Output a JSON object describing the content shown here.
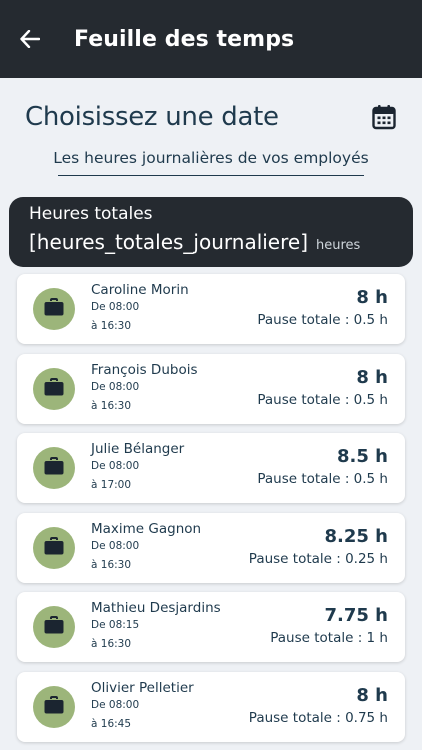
{
  "appbar": {
    "title": "Feuille des temps"
  },
  "header": {
    "title": "Choisissez une date",
    "subtitle": "Les heures journalières de vos employés"
  },
  "total": {
    "label": "Heures totales",
    "value": "[heures_totales_journaliere]",
    "unit": "heures"
  },
  "employees": [
    {
      "name": "Caroline Morin",
      "start": "De 08:00",
      "end": "à 16:30",
      "hours": "8 h",
      "pause": "Pause totale : 0.5 h"
    },
    {
      "name": "François Dubois",
      "start": "De 08:00",
      "end": "à 16:30",
      "hours": "8 h",
      "pause": "Pause totale : 0.5 h"
    },
    {
      "name": "Julie Bélanger",
      "start": "De 08:00",
      "end": "à 17:00",
      "hours": "8.5 h",
      "pause": "Pause totale : 0.5 h"
    },
    {
      "name": "Maxime Gagnon",
      "start": "De 08:00",
      "end": "à 16:30",
      "hours": "8.25 h",
      "pause": "Pause totale : 0.25 h"
    },
    {
      "name": "Mathieu Desjardins",
      "start": "De 08:15",
      "end": "à 16:30",
      "hours": "7.75 h",
      "pause": "Pause totale : 1 h"
    },
    {
      "name": "Olivier Pelletier",
      "start": "De 08:00",
      "end": "à 16:45",
      "hours": "8 h",
      "pause": "Pause totale : 0.75 h"
    }
  ],
  "colors": {
    "appbar": "#252a30",
    "background": "#eef1f5",
    "text": "#1f3a4d",
    "avatar": "#9cb57a"
  },
  "icons": {
    "back": "arrow-left-icon",
    "calendar": "calendar-icon",
    "employee": "briefcase-icon"
  }
}
